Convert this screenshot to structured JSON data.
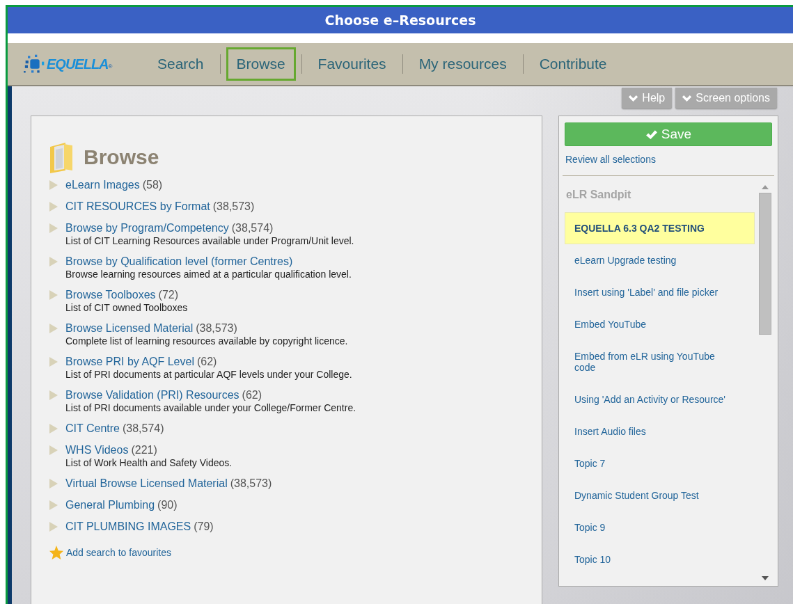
{
  "window": {
    "title": "Choose e–Resources"
  },
  "logo": {
    "text": "EQUELLA",
    "mark": "®"
  },
  "nav": [
    {
      "label": "Search",
      "selected": false
    },
    {
      "label": "Browse",
      "selected": true
    },
    {
      "label": "Favourites",
      "selected": false
    },
    {
      "label": "My resources",
      "selected": false
    },
    {
      "label": "Contribute",
      "selected": false
    }
  ],
  "toolbar": [
    "Help",
    "Screen options"
  ],
  "browse": {
    "title": "Browse",
    "items": [
      {
        "name": "eLearn Images",
        "count": "(58)"
      },
      {
        "name": "CIT RESOURCES by Format",
        "count": "(38,573)"
      },
      {
        "name": "Browse by Program/Competency",
        "count": "(38,574)",
        "description": "List of CIT Learning Resources available under Program/Unit level."
      },
      {
        "name": "Browse by Qualification level (former Centres)",
        "description": "Browse learning resources aimed at a particular qualification level."
      },
      {
        "name": "Browse Toolboxes",
        "count": "(72)",
        "description": "List of CIT owned Toolboxes"
      },
      {
        "name": "Browse Licensed Material",
        "count": "(38,573)",
        "description": "Complete list of learning resources available by copyright licence."
      },
      {
        "name": "Browse PRI by AQF Level",
        "count": "(62)",
        "description": "List of PRI documents at particular AQF levels under your College."
      },
      {
        "name": "Browse Validation (PRI) Resources",
        "count": "(62)",
        "description": "List of PRI documents available under your College/Former Centre."
      },
      {
        "name": "CIT Centre",
        "count": "(38,574)"
      },
      {
        "name": "WHS Videos",
        "count": "(221)",
        "description": "List of Work Health and Safety Videos."
      },
      {
        "name": "Virtual Browse Licensed Material",
        "count": "(38,573)"
      },
      {
        "name": "General Plumbing",
        "count": "(90)"
      },
      {
        "name": "CIT PLUMBING IMAGES",
        "count": "(79)"
      }
    ],
    "favourite_link": "Add search to favourites"
  },
  "selections": {
    "save": "Save",
    "review_link": "Review all selections",
    "course": "eLR Sandpit",
    "items": [
      {
        "label": "EQUELLA 6.3 QA2 TESTING",
        "selected": true
      },
      {
        "label": "eLearn Upgrade testing",
        "selected": false
      },
      {
        "label": "Insert using 'Label' and file picker",
        "selected": false
      },
      {
        "label": "Embed YouTube",
        "selected": false
      },
      {
        "label": "Embed from eLR using YouTube code",
        "selected": false
      },
      {
        "label": "Using 'Add an Activity or Resource'",
        "selected": false
      },
      {
        "label": "Insert Audio files",
        "selected": false
      },
      {
        "label": "Topic 7",
        "selected": false
      },
      {
        "label": "Dynamic Student Group Test",
        "selected": false
      },
      {
        "label": "Topic 9",
        "selected": false
      },
      {
        "label": "Topic 10",
        "selected": false
      }
    ]
  }
}
